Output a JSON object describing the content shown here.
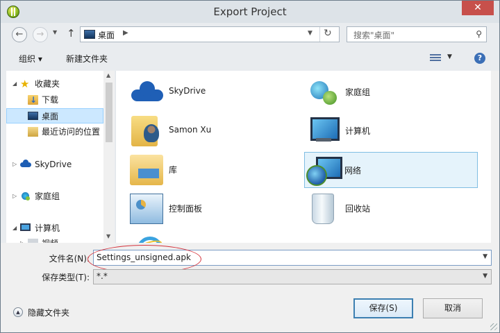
{
  "window": {
    "title": "Export Project",
    "close_label": "✕"
  },
  "address": {
    "location": "桌面",
    "search_placeholder": "搜索\"桌面\""
  },
  "toolbar": {
    "organize_label": "组织 ▾",
    "new_folder_label": "新建文件夹",
    "help_label": "?"
  },
  "nav": {
    "items": [
      {
        "label": "收藏夹",
        "icon": "star-icon"
      },
      {
        "label": "下载",
        "icon": "download-folder-icon"
      },
      {
        "label": "桌面",
        "icon": "desktop-icon",
        "selected": true
      },
      {
        "label": "最近访问的位置",
        "icon": "recent-places-icon"
      },
      {
        "label": "SkyDrive",
        "icon": "skydrive-icon"
      },
      {
        "label": "家庭组",
        "icon": "homegroup-icon"
      },
      {
        "label": "计算机",
        "icon": "computer-icon"
      },
      {
        "label": "视频",
        "icon": "video-icon"
      }
    ]
  },
  "content": {
    "items": [
      {
        "label": "SkyDrive",
        "icon": "skydrive-icon"
      },
      {
        "label": "家庭组",
        "icon": "homegroup-icon"
      },
      {
        "label": "Samon Xu",
        "icon": "user-folder-icon"
      },
      {
        "label": "计算机",
        "icon": "computer-icon"
      },
      {
        "label": "库",
        "icon": "libraries-icon"
      },
      {
        "label": "网络",
        "icon": "network-icon",
        "selected": true
      },
      {
        "label": "控制面板",
        "icon": "control-panel-icon"
      },
      {
        "label": "回收站",
        "icon": "recycle-bin-icon"
      },
      {
        "label": "",
        "icon": "internet-explorer-icon"
      }
    ]
  },
  "form": {
    "filename_label": "文件名(N):",
    "filename_value": "Settings_unsigned.apk",
    "filetype_label": "保存类型(T):",
    "filetype_value": "*.*"
  },
  "footer": {
    "hide_folders_label": "隐藏文件夹",
    "save_label": "保存(S)",
    "cancel_label": "取消"
  },
  "colors": {
    "selection": "#cce8ff",
    "tile_selection": "#e5f3fb",
    "annotation_ellipse": "#d5343e",
    "accent": "#3c7fb1"
  }
}
